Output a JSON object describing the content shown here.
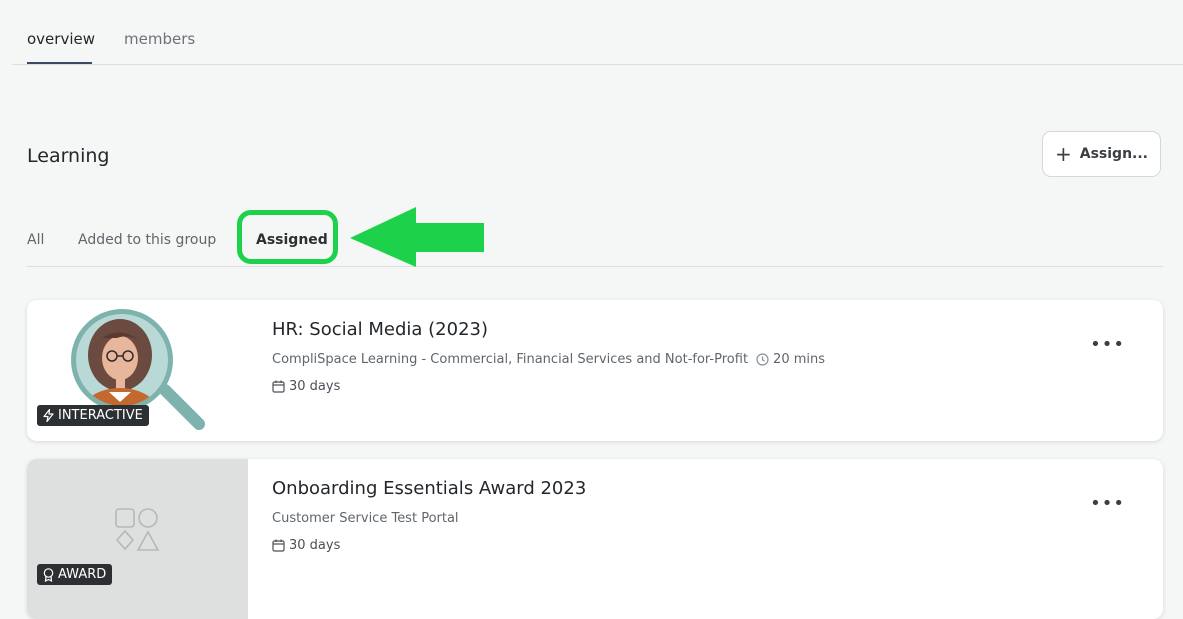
{
  "top_tabs": [
    {
      "label": "overview",
      "active": true
    },
    {
      "label": "members",
      "active": false
    }
  ],
  "section": {
    "title": "Learning",
    "assign_button": "Assign..."
  },
  "filters": [
    {
      "label": "All",
      "active": false
    },
    {
      "label": "Added to this group",
      "active": false
    },
    {
      "label": "Assigned",
      "active": true
    }
  ],
  "annotation": {
    "color": "#1ed14a",
    "highlight": "Assigned"
  },
  "cards": [
    {
      "title": "HR: Social Media (2023)",
      "source": "CompliSpace Learning - Commercial, Financial Services and Not-for-Profit",
      "duration": "20 mins",
      "days": "30 days",
      "badge": "INTERACTIVE",
      "badge_icon": "lightning-icon",
      "thumb": "woman-magnifier-illustration"
    },
    {
      "title": "Onboarding Essentials Award 2023",
      "source": "Customer Service Test Portal",
      "duration": "",
      "days": "30 days",
      "badge": "AWARD",
      "badge_icon": "award-ribbon-icon",
      "thumb": "shapes-placeholder-icon"
    }
  ],
  "more_label": "•••"
}
